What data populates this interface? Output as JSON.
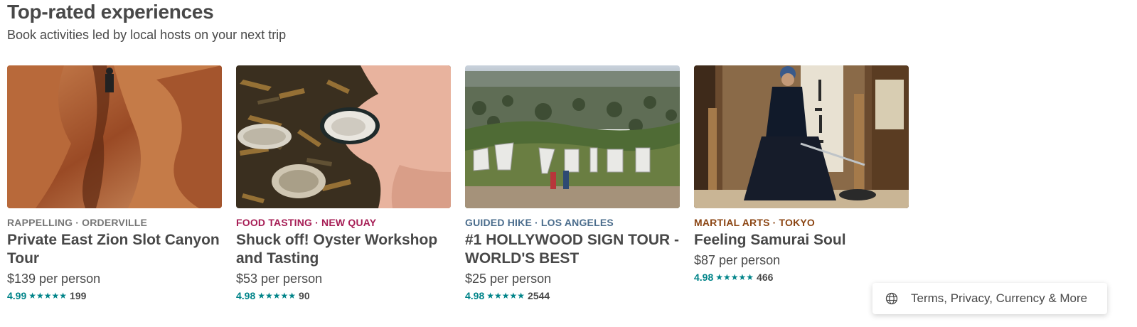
{
  "section": {
    "title": "Top-rated experiences",
    "subtitle": "Book activities led by local hosts on your next trip"
  },
  "cards": [
    {
      "category": "RAPPELLING",
      "location": "ORDERVILLE",
      "category_color": "#767676",
      "title": "Private East Zion Slot Canyon Tour",
      "price": "$139 per person",
      "score": "4.99",
      "stars": "★★★★★",
      "count": "199"
    },
    {
      "category": "FOOD TASTING",
      "location": "NEW QUAY",
      "category_color": "#A61D55",
      "title": "Shuck off! Oyster Workshop and Tasting",
      "price": "$53 per person",
      "score": "4.98",
      "stars": "★★★★★",
      "count": "90"
    },
    {
      "category": "GUIDED HIKE",
      "location": "LOS ANGELES",
      "category_color": "#4A6C8C",
      "title": "#1 HOLLYWOOD SIGN TOUR - WORLD'S BEST",
      "price": "$25 per person",
      "score": "4.98",
      "stars": "★★★★★",
      "count": "2544"
    },
    {
      "category": "MARTIAL ARTS",
      "location": "TOKYO",
      "category_color": "#8B4513",
      "title": "Feeling Samurai Soul",
      "price": "$87 per person",
      "score": "4.98",
      "stars": "★★★★★",
      "count": "466"
    }
  ],
  "footer": {
    "label": "Terms, Privacy, Currency & More",
    "icon": "globe-icon"
  },
  "colors": {
    "accent": "#008489",
    "text": "#484848"
  }
}
